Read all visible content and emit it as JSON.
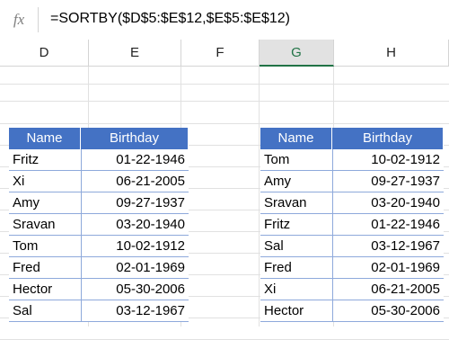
{
  "formula_bar": {
    "fx_label": "fx",
    "formula": "=SORTBY($D$5:$E$12,$E$5:$E$12)"
  },
  "columns": {
    "D": "D",
    "E": "E",
    "F": "F",
    "G": "G",
    "H": "H"
  },
  "selected_column": "G",
  "header_color": "#4472c4",
  "left_table": {
    "headers": [
      "Name",
      "Birthday"
    ],
    "rows": [
      [
        "Fritz",
        "01-22-1946"
      ],
      [
        "Xi",
        "06-21-2005"
      ],
      [
        "Amy",
        "09-27-1937"
      ],
      [
        "Sravan",
        "03-20-1940"
      ],
      [
        "Tom",
        "10-02-1912"
      ],
      [
        "Fred",
        "02-01-1969"
      ],
      [
        "Hector",
        "05-30-2006"
      ],
      [
        "Sal",
        "03-12-1967"
      ]
    ]
  },
  "right_table": {
    "headers": [
      "Name",
      "Birthday"
    ],
    "rows": [
      [
        "Tom",
        "10-02-1912"
      ],
      [
        "Amy",
        "09-27-1937"
      ],
      [
        "Sravan",
        "03-20-1940"
      ],
      [
        "Fritz",
        "01-22-1946"
      ],
      [
        "Sal",
        "03-12-1967"
      ],
      [
        "Fred",
        "02-01-1969"
      ],
      [
        "Xi",
        "06-21-2005"
      ],
      [
        "Hector",
        "05-30-2006"
      ]
    ]
  }
}
